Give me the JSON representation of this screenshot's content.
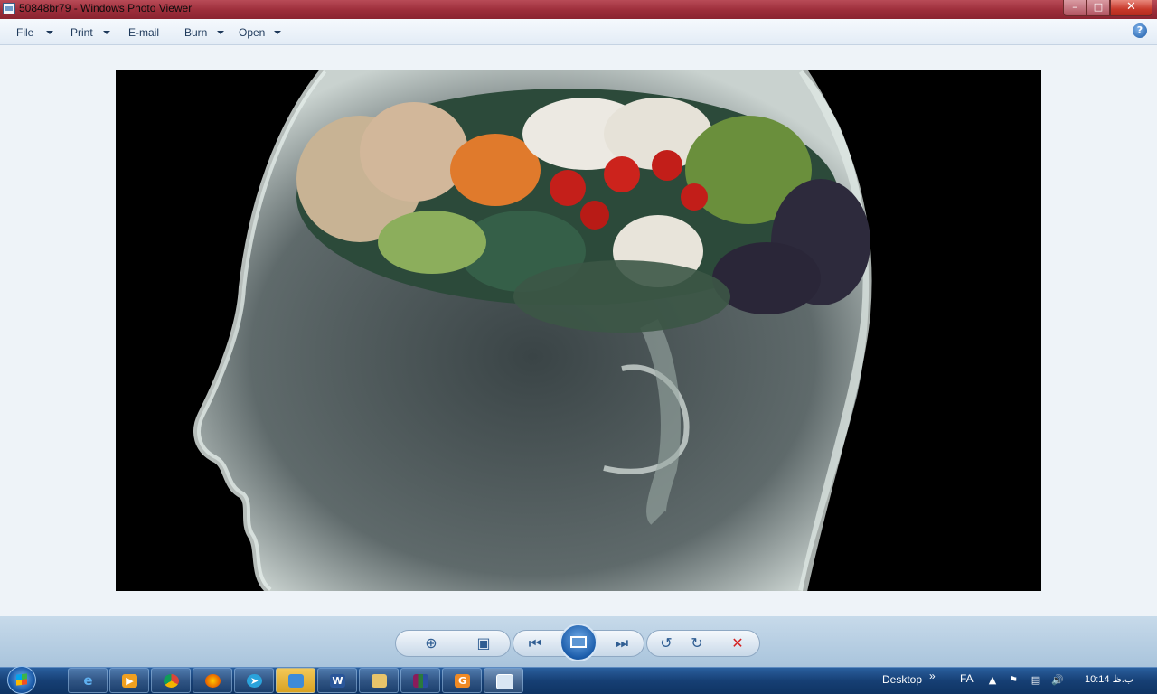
{
  "window": {
    "title": "50848br79 - Windows Photo Viewer",
    "controls": {
      "minimize": "–",
      "maximize": "□",
      "close": "✕"
    }
  },
  "menu": {
    "items": [
      {
        "label": "File",
        "dropdown": true
      },
      {
        "label": "Print",
        "dropdown": true
      },
      {
        "label": "E-mail",
        "dropdown": false
      },
      {
        "label": "Burn",
        "dropdown": true
      },
      {
        "label": "Open",
        "dropdown": true
      }
    ],
    "help": "?"
  },
  "photo": {
    "subject": "head-silhouette-with-vegetable-brain"
  },
  "controls": {
    "zoom": "zoom-icon",
    "actual_size": "actual-size-icon",
    "previous": "previous-icon",
    "slideshow": "slideshow-icon",
    "next": "next-icon",
    "rotate_ccw": "rotate-counterclockwise-icon",
    "rotate_cw": "rotate-clockwise-icon",
    "delete": "delete-icon"
  },
  "taskbar": {
    "apps": [
      "internet-explorer-icon",
      "media-player-icon",
      "chrome-icon",
      "firefox-icon",
      "telegram-icon",
      "photo-viewer-small-icon",
      "word-icon",
      "file-explorer-icon",
      "winrar-icon",
      "app-g-icon",
      "photo-viewer-active-icon"
    ],
    "desktop_label": "Desktop",
    "chevron": "»",
    "language": "FA",
    "clock": "10:14 ب.ظ"
  },
  "colors": {
    "titlebar": "#9c2d3a",
    "taskbar": "#163f74",
    "accent": "#1b5caa",
    "delete": "#d42020"
  }
}
